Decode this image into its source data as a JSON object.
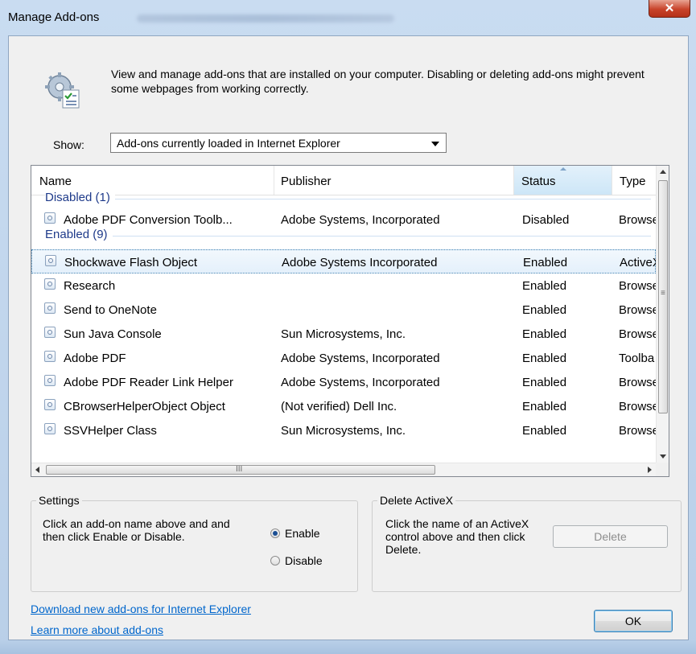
{
  "window": {
    "title": "Manage Add-ons",
    "close_glyph": "✕"
  },
  "header": {
    "icon": "gear-checklist-icon",
    "description": "View and manage add-ons that are installed on your computer. Disabling or deleting add-ons might prevent some webpages from working correctly."
  },
  "show": {
    "label": "Show:",
    "selected": "Add-ons currently loaded in Internet Explorer"
  },
  "list": {
    "columns": [
      "Name",
      "Publisher",
      "Status",
      "Type"
    ],
    "sorted_column": "Status",
    "groups": [
      {
        "title": "Disabled (1)",
        "rows": [
          {
            "name": "Adobe PDF Conversion Toolb...",
            "publisher": "Adobe Systems, Incorporated",
            "status": "Disabled",
            "type": "Browse"
          }
        ]
      },
      {
        "title": "Enabled (9)",
        "rows": [
          {
            "name": "Shockwave Flash Object",
            "publisher": "Adobe Systems Incorporated",
            "status": "Enabled",
            "type": "ActiveX",
            "selected": true
          },
          {
            "name": "Research",
            "publisher": "",
            "status": "Enabled",
            "type": "Browse"
          },
          {
            "name": "Send to OneNote",
            "publisher": "",
            "status": "Enabled",
            "type": "Browse"
          },
          {
            "name": "Sun Java Console",
            "publisher": "Sun Microsystems, Inc.",
            "status": "Enabled",
            "type": "Browse"
          },
          {
            "name": "Adobe PDF",
            "publisher": "Adobe Systems, Incorporated",
            "status": "Enabled",
            "type": "Toolba"
          },
          {
            "name": "Adobe PDF Reader Link Helper",
            "publisher": "Adobe Systems, Incorporated",
            "status": "Enabled",
            "type": "Browse"
          },
          {
            "name": "CBrowserHelperObject Object",
            "publisher": "(Not verified) Dell Inc.",
            "status": "Enabled",
            "type": "Browse"
          },
          {
            "name": "SSVHelper Class",
            "publisher": "Sun Microsystems, Inc.",
            "status": "Enabled",
            "type": "Browse"
          }
        ]
      }
    ]
  },
  "settings": {
    "title": "Settings",
    "text": "Click an add-on name above and and then click Enable or Disable.",
    "enable_label": "Enable",
    "disable_label": "Disable",
    "selected": "Enable"
  },
  "delete_activex": {
    "title": "Delete ActiveX",
    "text": "Click the name of an ActiveX control above and then click Delete.",
    "button": "Delete"
  },
  "footer": {
    "link_download": "Download new add-ons for Internet Explorer",
    "link_learn": "Learn more about add-ons",
    "ok": "OK"
  }
}
